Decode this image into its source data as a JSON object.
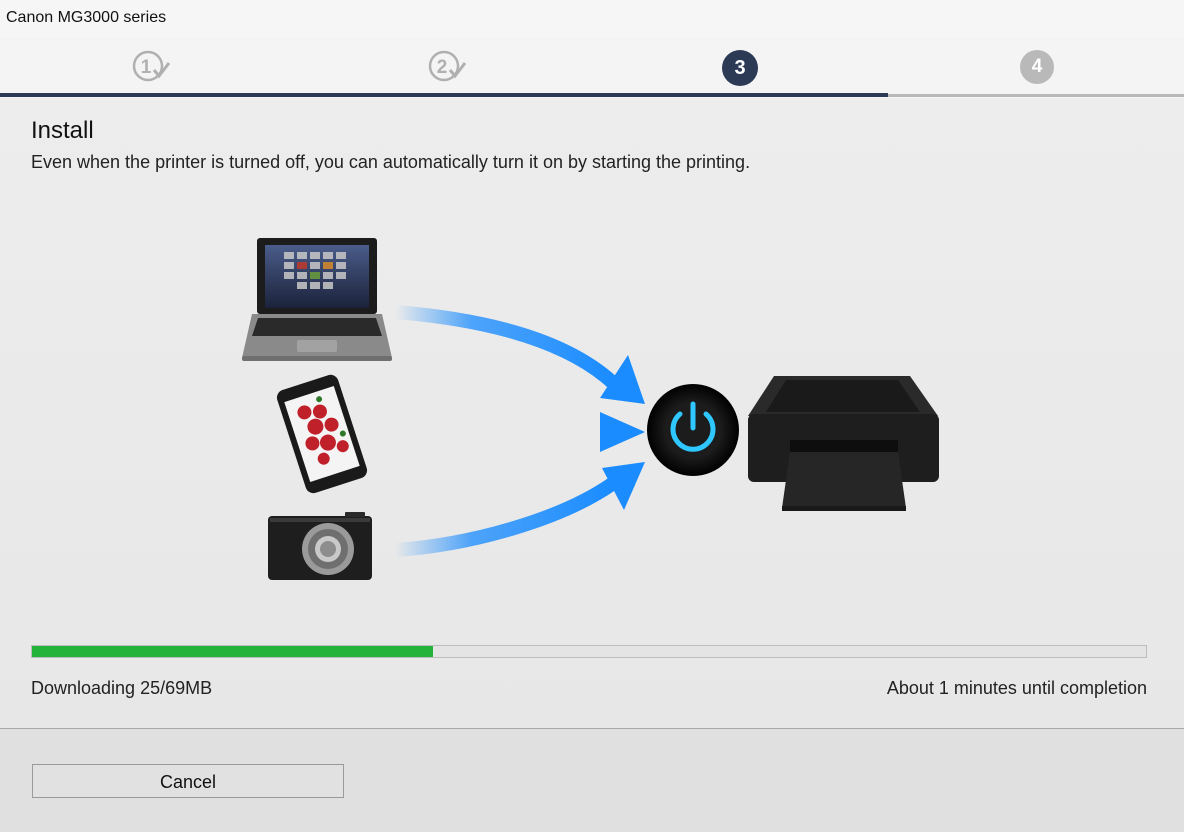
{
  "window": {
    "title": "Canon MG3000 series"
  },
  "steps": [
    {
      "number": "1",
      "state": "done"
    },
    {
      "number": "2",
      "state": "done"
    },
    {
      "number": "3",
      "state": "active"
    },
    {
      "number": "4",
      "state": "pending"
    }
  ],
  "colors": {
    "step_active": "#2d3a55",
    "step_done": "#b0b0b0",
    "progress": "#23b33a",
    "arrow": "#1a8cff"
  },
  "main": {
    "heading": "Install",
    "description": "Even when the printer is turned off, you can automatically turn it on by starting the printing."
  },
  "illustration": {
    "icons": [
      "laptop-icon",
      "smartphone-icon",
      "camera-icon",
      "power-icon",
      "printer-icon"
    ]
  },
  "progress": {
    "fraction": 0.36,
    "status_left": "Downloading 25/69MB",
    "status_right": "About 1 minutes until completion"
  },
  "footer": {
    "cancel_label": "Cancel"
  }
}
